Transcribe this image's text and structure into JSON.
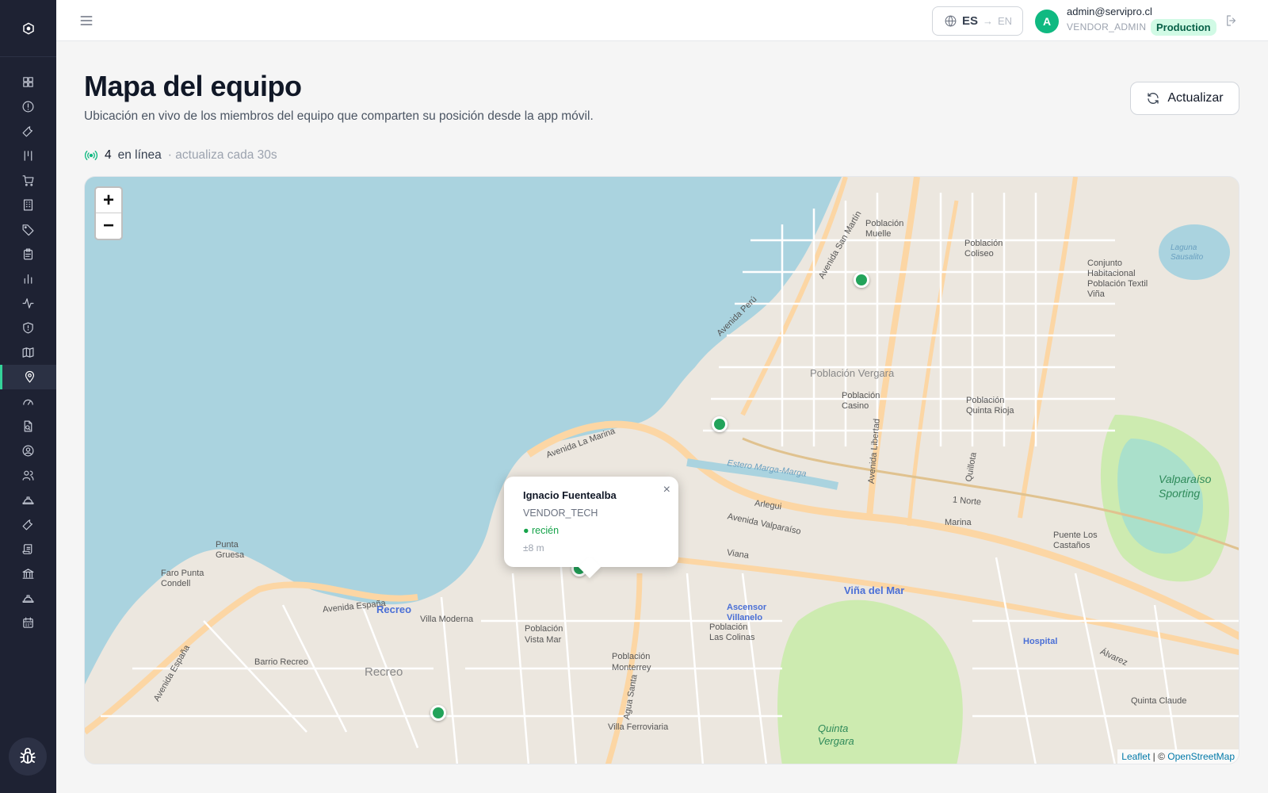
{
  "sidebar": {
    "items": [
      {
        "icon": "dashboard-icon"
      },
      {
        "icon": "alert-circle-icon"
      },
      {
        "icon": "wrench-icon"
      },
      {
        "icon": "columns-icon"
      },
      {
        "icon": "cart-icon"
      },
      {
        "icon": "building-icon"
      },
      {
        "icon": "tag-icon"
      },
      {
        "icon": "clipboard-icon"
      },
      {
        "icon": "bar-chart-icon"
      },
      {
        "icon": "activity-icon"
      },
      {
        "icon": "shield-icon"
      },
      {
        "icon": "map-icon"
      },
      {
        "icon": "map-pin-icon",
        "active": true
      },
      {
        "icon": "gauge-icon"
      },
      {
        "icon": "file-search-icon"
      },
      {
        "icon": "user-circle-icon"
      },
      {
        "icon": "users-icon"
      },
      {
        "icon": "hard-hat-icon"
      },
      {
        "icon": "tool-icon"
      },
      {
        "icon": "scroll-icon"
      },
      {
        "icon": "bank-icon"
      },
      {
        "icon": "hard-hat-alt-icon"
      },
      {
        "icon": "calendar-icon"
      }
    ],
    "bug_icon": "bug-icon"
  },
  "topbar": {
    "lang_current": "ES",
    "lang_arrow": "→",
    "lang_next": "EN",
    "avatar_initial": "A",
    "user_email": "admin@servipro.cl",
    "user_role": "VENDOR_ADMIN",
    "environment": "Production"
  },
  "page": {
    "title": "Mapa del equipo",
    "subtitle": "Ubicación en vivo de los miembros del equipo que comparten su posición desde la app móvil.",
    "refresh_label": "Actualizar",
    "online_count": "4",
    "online_label": "en línea",
    "refresh_note": "· actualiza cada 30s"
  },
  "map": {
    "zoom_in": "+",
    "zoom_out": "−",
    "popup": {
      "name": "Ignacio Fuentealba",
      "role": "VENDOR_TECH",
      "status": "● recién",
      "accuracy": "±8 m",
      "close": "×"
    },
    "attribution": {
      "leaflet": "Leaflet",
      "separator": " | © ",
      "osm": "OpenStreetMap"
    },
    "labels": {
      "vina": "Viña del Mar",
      "recreo": "Recreo",
      "recreo_area": "Recreo",
      "vergara": "Población Vergara",
      "sporting": "Valparaíso Sporting",
      "quinta": "Quinta Vergara",
      "estero": "Estero Marga-Marga",
      "ascensor": "Ascensor Villanelo",
      "hospital": "Hospital",
      "villa_moderna": "Villa Moderna",
      "barrio_recreo": "Barrio Recreo",
      "vista_mar": "Población Vista Mar",
      "ferroviaria": "Villa Ferroviaria",
      "monterrey": "Población Monterrey",
      "punta_gruesa": "Punta Gruesa",
      "faro": "Faro Punta Condell",
      "casino": "Población Casino",
      "quinta_rioja": "Población Quinta Rioja",
      "muelle": "Población Muelle",
      "coliseo": "Población Coliseo",
      "textil": "Conjunto Habitacional Población Textil Viña",
      "laguna": "Laguna Sausalito",
      "las_colinas": "Población Las Colinas",
      "quinta_claude": "Quinta Claude",
      "av_espana": "Avenida España",
      "av_peru": "Avenida Perú",
      "av_marina": "Avenida La Marina",
      "av_libertad": "Avenida Libertad",
      "av_san_martin": "Avenida San Martín",
      "alvarez": "Álvarez",
      "viana": "Viana",
      "marina": "Marina",
      "arlegui": "Arlegui",
      "valparaiso": "Avenida Valparaíso",
      "agua_santa": "Agua Santa",
      "quillota": "Quillota",
      "uno_norte": "1 Norte",
      "puente": "Puente Los Castaños"
    }
  },
  "colors": {
    "sidebar_bg": "#1e2233",
    "accent": "#10b981",
    "marker": "#22a35a",
    "sea": "#aad3df",
    "land": "#ece7df"
  }
}
